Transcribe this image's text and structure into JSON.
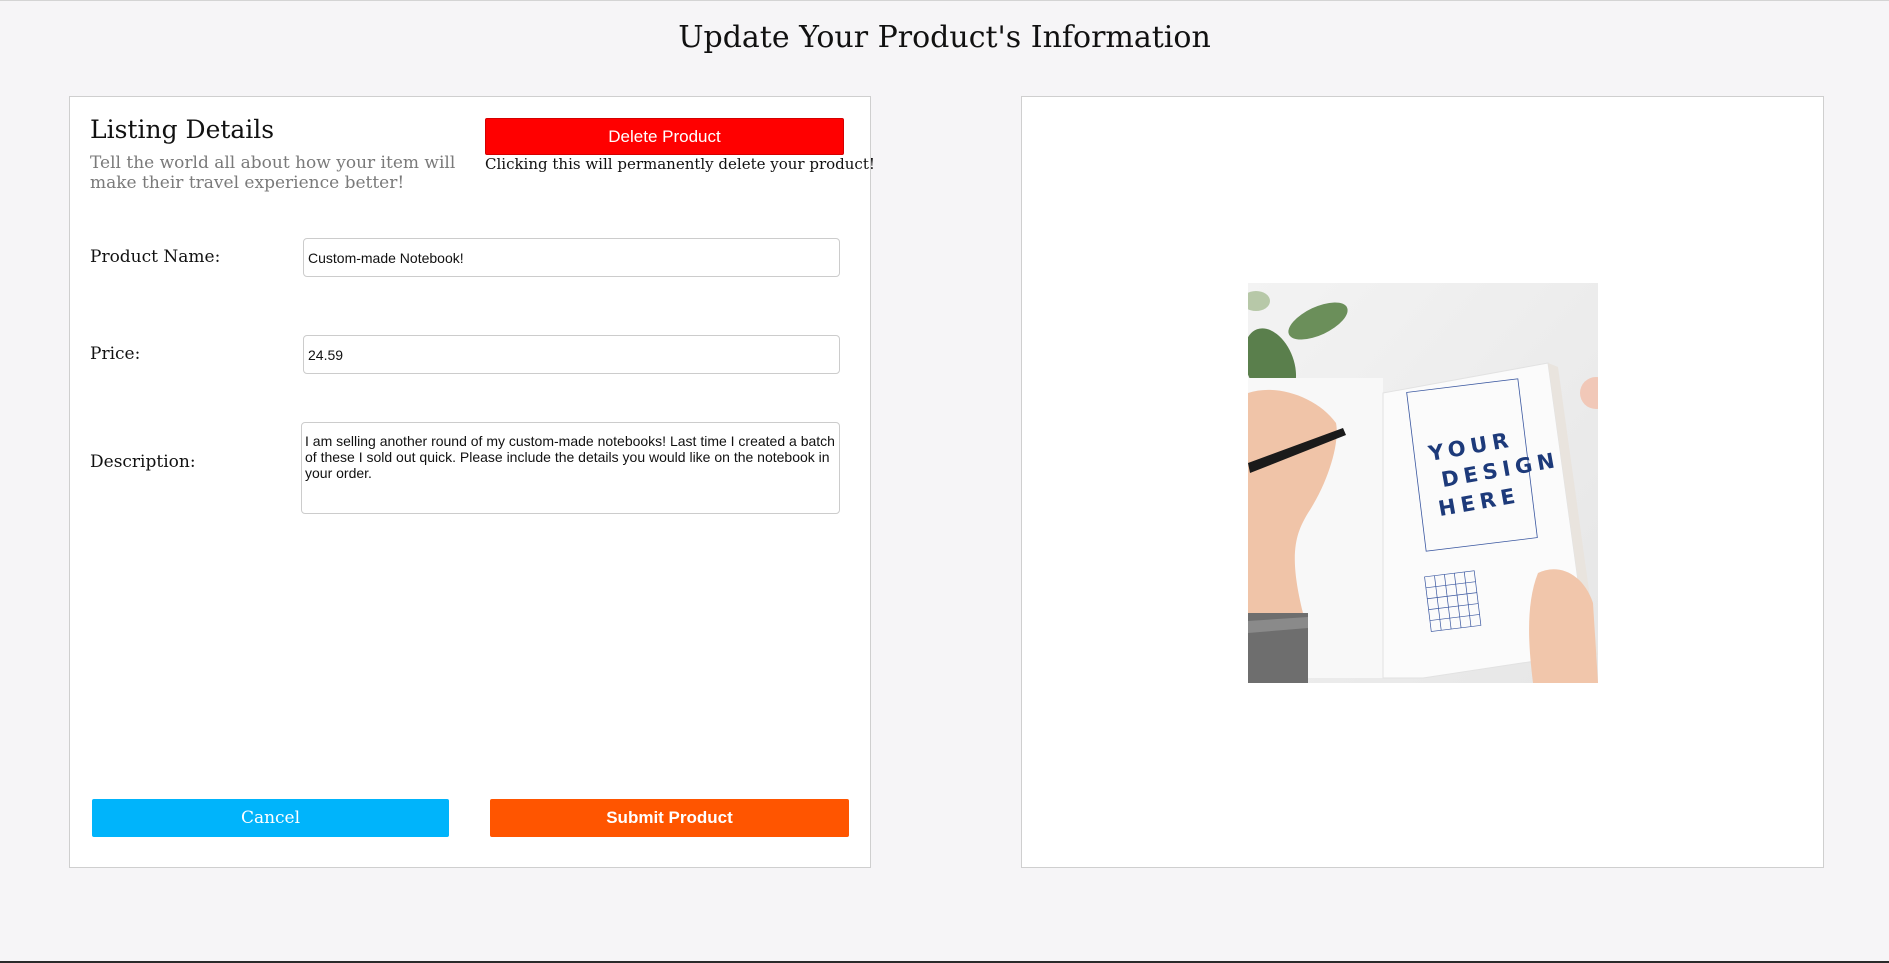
{
  "page": {
    "title": "Update Your Product's Information"
  },
  "listing": {
    "title": "Listing Details",
    "subtitle": "Tell the world all about how your item will make their travel experience better!",
    "delete_label": "Delete Product",
    "delete_warning": "Clicking this will permanently delete your product!"
  },
  "form": {
    "name_label": "Product Name:",
    "name_value": "Custom-made Notebook!",
    "price_label": "Price:",
    "price_value": "24.59",
    "description_label": "Description:",
    "description_value": "I am selling another round of my custom-made notebooks! Last time I created a batch of these I sold out quick. Please include the details you would like on the notebook in your order."
  },
  "actions": {
    "cancel_label": "Cancel",
    "submit_label": "Submit Product"
  },
  "image": {
    "notebook_text": "YOUR DESIGN HERE"
  },
  "colors": {
    "delete": "#ff0000",
    "cancel": "#00b4fb",
    "submit": "#ff5500",
    "notebook_text": "#1d3a7a"
  }
}
